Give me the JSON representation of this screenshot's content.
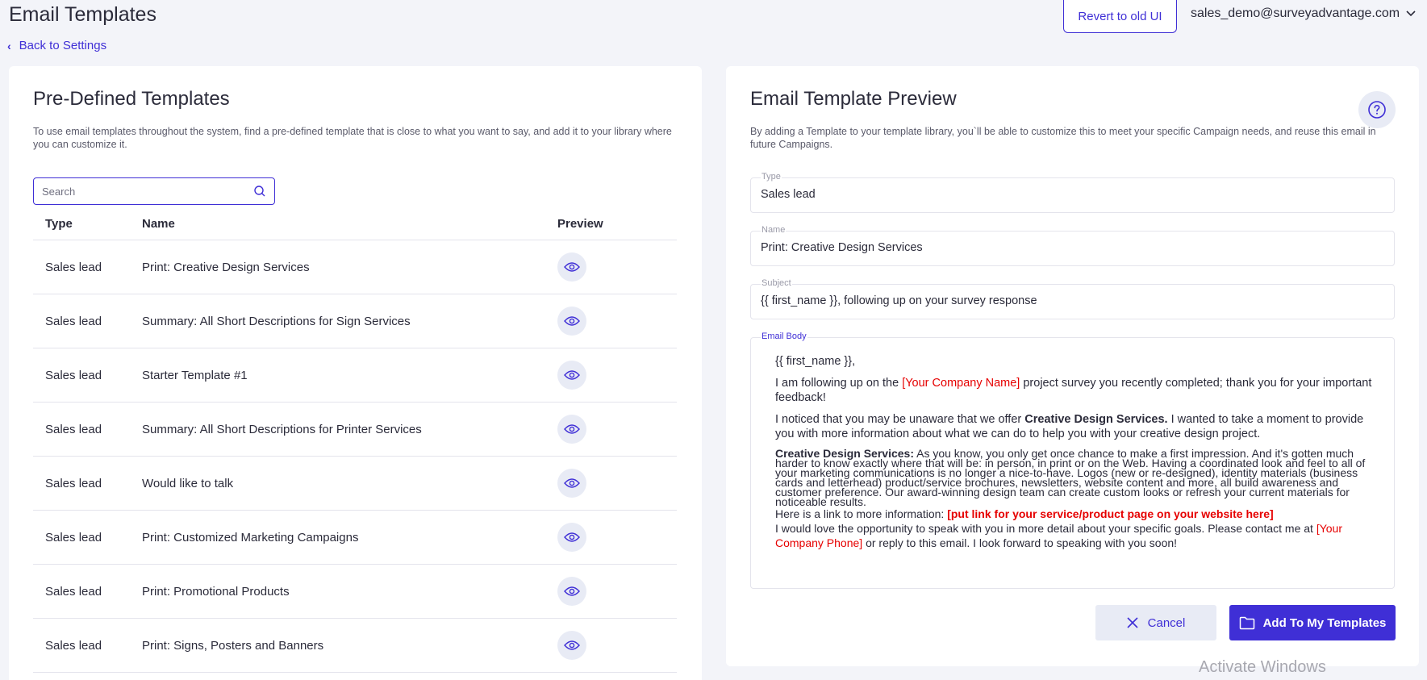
{
  "header": {
    "title": "Email Templates",
    "back_label": "Back to Settings",
    "revert_label": "Revert to old UI",
    "user_email": "sales_demo@surveyadvantage.com"
  },
  "left": {
    "title": "Pre-Defined Templates",
    "description": "To use email templates throughout the system, find a pre-defined template that is close to what you want to say, and add it to your library where you can customize it.",
    "search_placeholder": "Search",
    "columns": {
      "type": "Type",
      "name": "Name",
      "preview": "Preview"
    },
    "rows": [
      {
        "type": "Sales lead",
        "name": "Print: Creative Design Services"
      },
      {
        "type": "Sales lead",
        "name": "Summary: All Short Descriptions for Sign Services"
      },
      {
        "type": "Sales lead",
        "name": "Starter Template #1"
      },
      {
        "type": "Sales lead",
        "name": "Summary: All Short Descriptions for Printer Services"
      },
      {
        "type": "Sales lead",
        "name": "Would like to talk"
      },
      {
        "type": "Sales lead",
        "name": "Print: Customized Marketing Campaigns"
      },
      {
        "type": "Sales lead",
        "name": "Print: Promotional Products"
      },
      {
        "type": "Sales lead",
        "name": "Print: Signs, Posters and Banners"
      }
    ]
  },
  "right": {
    "title": "Email Template Preview",
    "description": "By adding a Template to your template library, you`ll be able to customize this to meet your specific Campaign needs, and reuse this email in future Campaigns.",
    "type_label": "Type",
    "type_value": "Sales lead",
    "name_label": "Name",
    "name_value": "Print: Creative Design Services",
    "subject_label": "Subject",
    "subject_value": "{{ first_name }}, following up on your survey response",
    "body_label": "Email Body",
    "body": {
      "greeting": "{{ first_name }},",
      "p1_a": "I am following up on the ",
      "p1_red": "[Your Company Name]",
      "p1_b": " project survey you recently completed; thank you for your important feedback!",
      "p2_a": "I noticed that you may be unaware that we offer ",
      "p2_bold": "Creative Design Services.",
      "p2_b": " I wanted to take a moment to provide you with more information about what we can do to help you with your creative design project.",
      "p3_bold": "Creative Design Services:",
      "p3_b": " As you know, you only get once chance to make a first impression. And it's gotten much harder to know exactly where that will be: in person, in print or on the Web. Having a coordinated look and feel to all of your marketing communications is no longer a nice-to-have. Logos (new or re-designed), identity materials (business cards and letterhead) product/service brochures, newsletters, website content and more, all build awareness and customer preference. Our award-winning design team can create custom looks or refresh your current materials for noticeable results.",
      "p4_a": "Here is a link to more information: ",
      "p4_red": "[put link for your service/product page on your website here]",
      "p5_a": "I would love the opportunity to speak with you in more detail about your specific goals. Please contact me at ",
      "p5_red": "[Your Company Phone]",
      "p5_b": " or reply to this email. I look forward to speaking with you soon!"
    },
    "cancel_label": "Cancel",
    "add_label": "Add To My Templates"
  },
  "watermark": "Activate Windows",
  "colors": {
    "accent": "#3f2fd6",
    "highlight": "#e60000",
    "icon_bg": "#e8ebf5"
  }
}
